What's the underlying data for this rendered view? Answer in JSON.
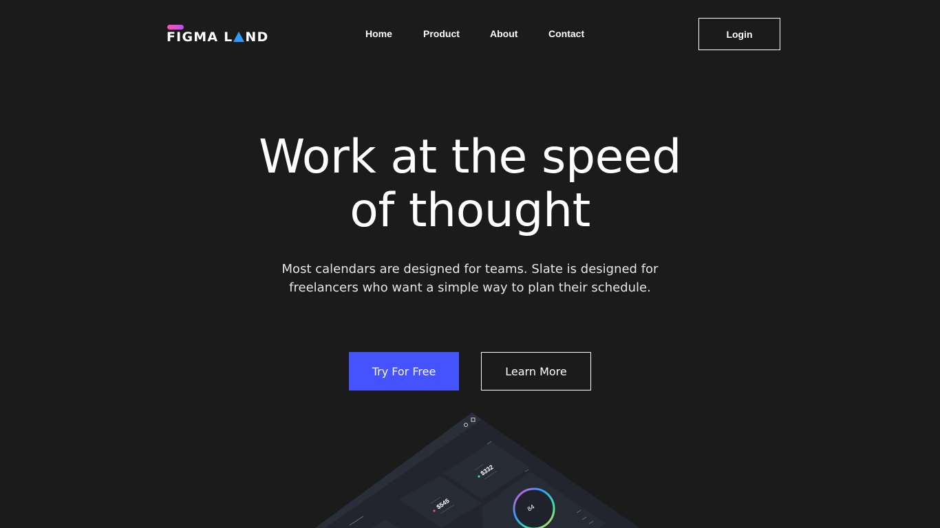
{
  "header": {
    "logo_text_left": "FIGMA L",
    "logo_text_right": "ND",
    "nav": [
      "Home",
      "Product",
      "About",
      "Contact"
    ],
    "login_label": "Login"
  },
  "hero": {
    "headline_line1": "Work at the speed",
    "headline_line2": "of thought",
    "subtitle_line1": "Most calendars are designed for teams. Slate is designed for",
    "subtitle_line2": "freelancers who want a simple way to plan their schedule.",
    "cta_primary": "Try For Free",
    "cta_secondary": "Learn More"
  },
  "mockup": {
    "stat_1": "$545",
    "stat_2": "$332",
    "gauge_value": "84"
  },
  "colors": {
    "background": "#1b1b1c",
    "primary": "#4453fe",
    "logo_pink": "#ff4fb8",
    "logo_blue": "#2f9bff"
  },
  "icons": {
    "logo_pill": "pink-pill-icon",
    "logo_triangle": "blue-triangle-icon"
  }
}
